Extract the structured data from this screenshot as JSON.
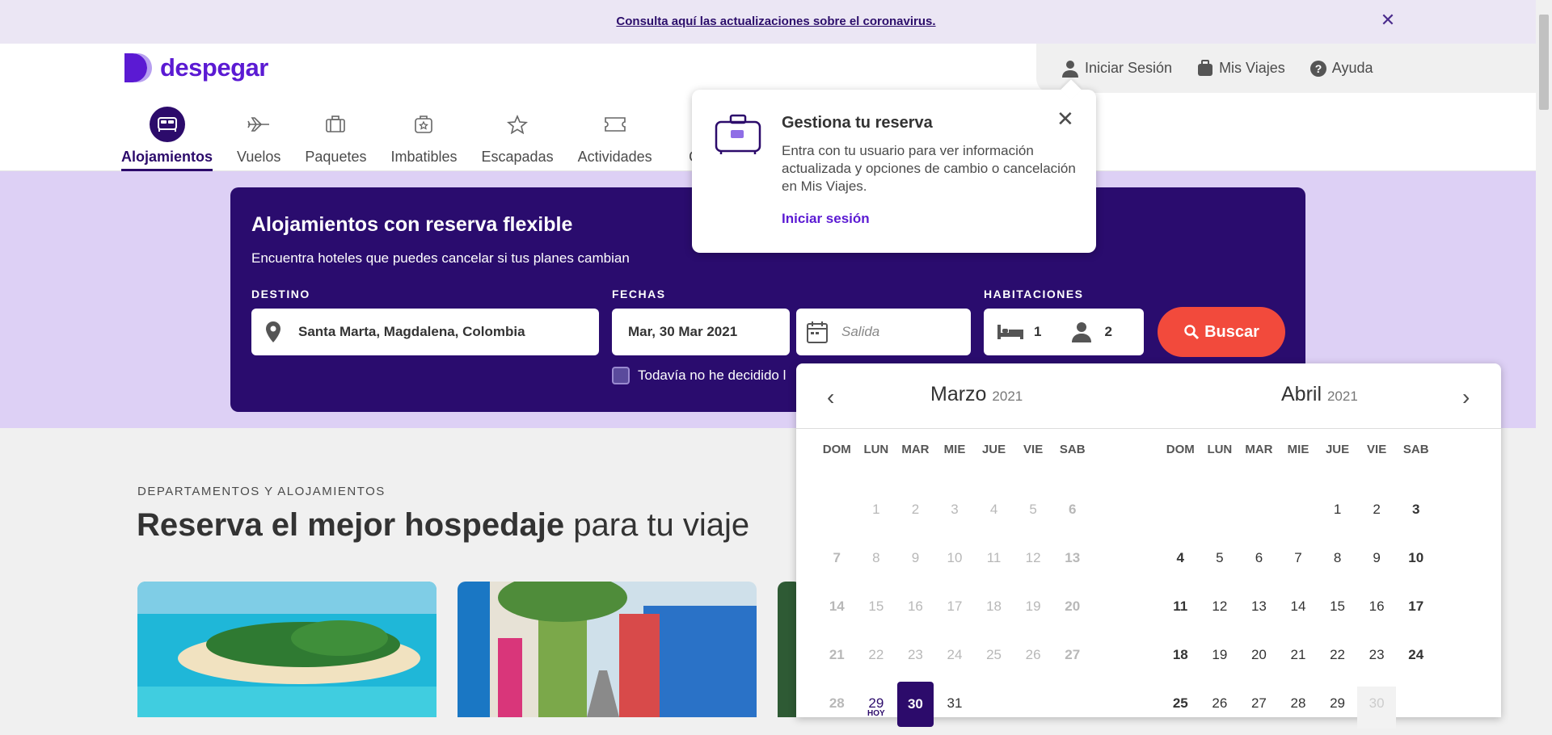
{
  "banner": {
    "link": "Consulta aquí las actualizaciones sobre el coronavirus.",
    "close": "✕"
  },
  "logo": {
    "word": "despegar"
  },
  "userbar": {
    "login": "Iniciar Sesión",
    "trips": "Mis Viajes",
    "help": "Ayuda"
  },
  "nav": [
    {
      "label": "Alojamientos"
    },
    {
      "label": "Vuelos"
    },
    {
      "label": "Paquetes"
    },
    {
      "label": "Imbatibles"
    },
    {
      "label": "Escapadas"
    },
    {
      "label": "Actividades"
    },
    {
      "label": "C"
    }
  ],
  "search": {
    "title": "Alojamientos con reserva flexible",
    "subtitle": "Encuentra hoteles que puedes cancelar si tus planes cambian",
    "destino_label": "DESTINO",
    "destino_value": "Santa Marta, Magdalena, Colombia",
    "fechas_label": "FECHAS",
    "checkin": "Mar, 30 Mar 2021",
    "checkout_placeholder": "Salida",
    "habitaciones_label": "HABITACIONES",
    "rooms": "1",
    "guests": "2",
    "button": "Buscar",
    "checkbox": "Todavía no he decidido l"
  },
  "section": {
    "label": "DEPARTAMENTOS Y ALOJAMIENTOS",
    "title_bold": "Reserva el mejor hospedaje",
    "title_rest": " para tu viaje"
  },
  "popover": {
    "title": "Gestiona tu reserva",
    "text": "Entra con tu usuario para ver información actualizada y opciones de cambio o cancelación en Mis Viajes.",
    "link": "Iniciar sesión",
    "close": "✕"
  },
  "calendar": {
    "weekdays": [
      "DOM",
      "LUN",
      "MAR",
      "MIE",
      "JUE",
      "VIE",
      "SAB"
    ],
    "left": {
      "month": "Marzo",
      "year": "2021"
    },
    "right": {
      "month": "Abril",
      "year": "2021"
    },
    "prev": "‹",
    "next": "›",
    "today_label": "HOY"
  },
  "colors": {
    "brand": "#5b1ad3",
    "dark": "#2c0b6b",
    "cta": "#f24a3c",
    "hero": "#ddd0f5"
  }
}
